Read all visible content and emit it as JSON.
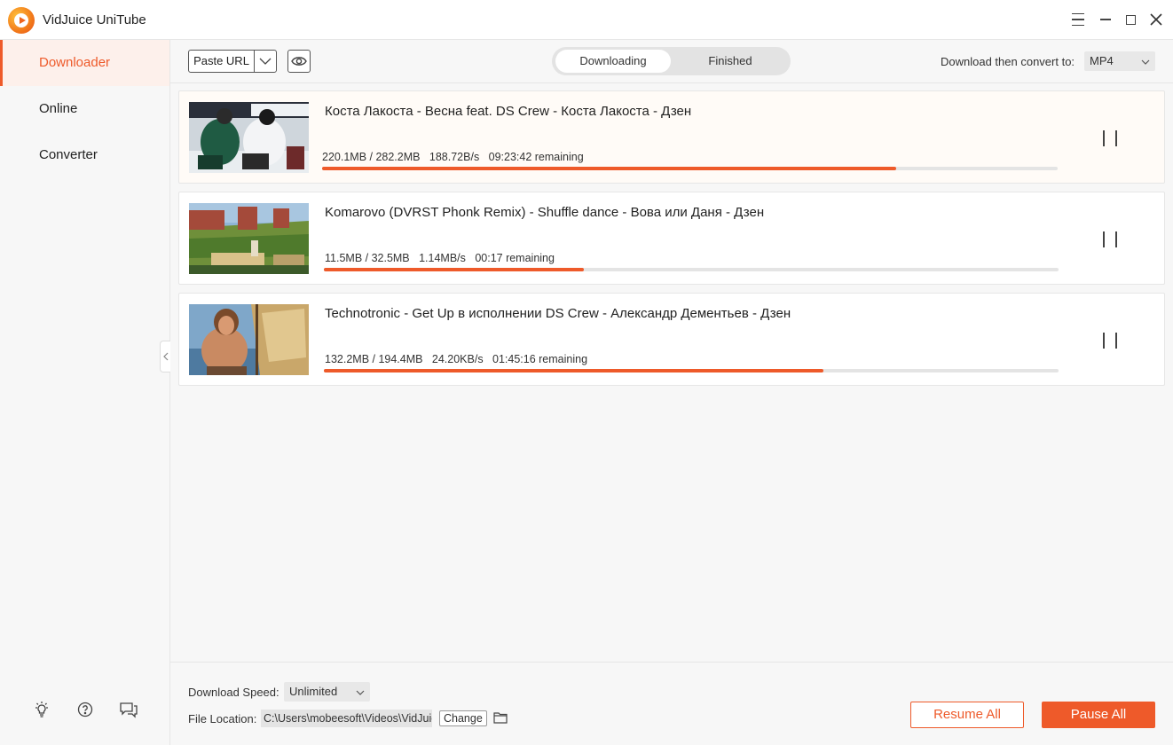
{
  "app": {
    "title": "VidJuice UniTube"
  },
  "sidebar": {
    "items": [
      {
        "label": "Downloader",
        "active": true
      },
      {
        "label": "Online",
        "active": false
      },
      {
        "label": "Converter",
        "active": false
      }
    ],
    "bottom_icons": [
      "lightbulb-icon",
      "help-icon",
      "feedback-icon"
    ]
  },
  "toolbar": {
    "paste_url_label": "Paste URL",
    "tabs": [
      {
        "label": "Downloading",
        "active": true
      },
      {
        "label": "Finished",
        "active": false
      }
    ],
    "convert_label": "Download then convert to:",
    "convert_format": "MP4"
  },
  "downloads": [
    {
      "title": "Коста Лакоста - Весна feat. DS Crew - Коста Лакоста - Дзен",
      "size": "220.1MB / 282.2MB",
      "speed": "188.72B/s",
      "remaining": "09:23:42 remaining",
      "progress": 0.78
    },
    {
      "title": "Komarovo (DVRST Phonk Remix) - Shuffle dance - Вова или Даня - Дзен",
      "size": "11.5MB / 32.5MB",
      "speed": "1.14MB/s",
      "remaining": "00:17 remaining",
      "progress": 0.354
    },
    {
      "title": "Technotronic - Get Up в исполнении DS Crew - Александр Дементьев - Дзен",
      "size": "132.2MB / 194.4MB",
      "speed": "24.20KB/s",
      "remaining": "01:45:16 remaining",
      "progress": 0.68
    }
  ],
  "footer": {
    "speed_label": "Download Speed:",
    "speed_value": "Unlimited",
    "location_label": "File Location:",
    "location_path": "C:\\Users\\mobeesoft\\Videos\\VidJuice",
    "change_label": "Change",
    "resume_all_label": "Resume All",
    "pause_all_label": "Pause All"
  },
  "colors": {
    "accent": "#ee5a2a",
    "sidebar_bg": "#f7f7f7",
    "active_bg": "#fdf0eb"
  }
}
